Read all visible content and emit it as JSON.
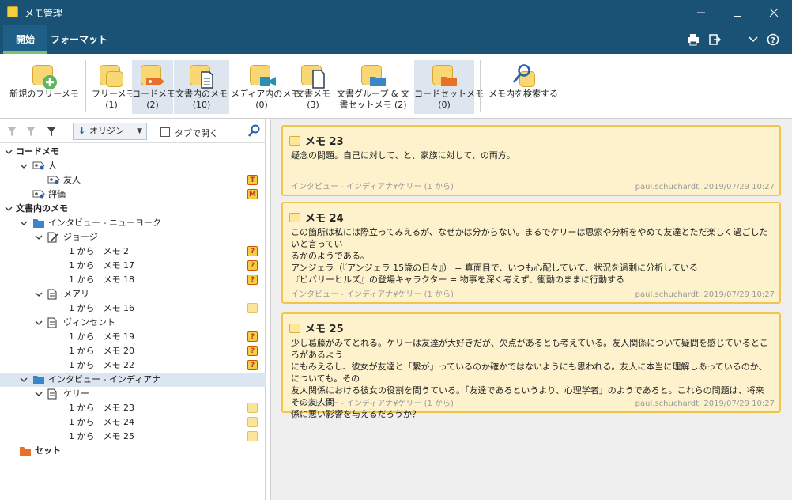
{
  "window": {
    "title": "メモ管理"
  },
  "tabs": {
    "start": "開始",
    "format": "フォーマット"
  },
  "ribbon": {
    "new_free": "新規のフリーメモ",
    "free": {
      "label": "フリーメモ",
      "count": "(1)"
    },
    "code": {
      "label": "コードメモ",
      "count": "(2)"
    },
    "doc": {
      "label": "文書内のメモ",
      "count": "(10)"
    },
    "media": {
      "label": "メディア内のメモ",
      "count": "(0)"
    },
    "docmemo": {
      "label": "文書メモ",
      "count": "(3)"
    },
    "docgroup": {
      "label": "文書グループ & 文",
      "label2": "書セットメモ (2)"
    },
    "codeset": {
      "label": "コードセットメモ",
      "count": "(0)"
    },
    "search": "メモ内を検索する"
  },
  "toolbar": {
    "origin": "オリジン",
    "tab_open": "タブで開く"
  },
  "tree": [
    {
      "label": "コードメモ",
      "level": 0,
      "exp": "v",
      "icon": "none",
      "bold": true
    },
    {
      "label": "人",
      "level": 1,
      "exp": "v",
      "icon": "code"
    },
    {
      "label": "友人",
      "level": 2,
      "exp": "",
      "icon": "code",
      "badge": "T"
    },
    {
      "label": "評価",
      "level": 1,
      "exp": "",
      "icon": "code",
      "badge": "M"
    },
    {
      "label": "文書内のメモ",
      "level": 0,
      "exp": "v",
      "icon": "none",
      "bold": true
    },
    {
      "label": "インタビュー - ニューヨーク",
      "level": 1,
      "exp": "v",
      "icon": "folder"
    },
    {
      "label": "ジョージ",
      "level": 2,
      "exp": "v",
      "icon": "docedit"
    },
    {
      "label": "1 から　メモ 2",
      "level": 3,
      "exp": "",
      "icon": "none",
      "badge": "?"
    },
    {
      "label": "1 から　メモ 17",
      "level": 3,
      "exp": "",
      "icon": "none",
      "badge": "?"
    },
    {
      "label": "1 から　メモ 18",
      "level": 3,
      "exp": "",
      "icon": "none",
      "badge": "?"
    },
    {
      "label": "メアリ",
      "level": 2,
      "exp": "v",
      "icon": "doc"
    },
    {
      "label": "1 から　メモ 16",
      "level": 3,
      "exp": "",
      "icon": "none",
      "badge": "N"
    },
    {
      "label": "ヴィンセント",
      "level": 2,
      "exp": "v",
      "icon": "doc"
    },
    {
      "label": "1 から　メモ 19",
      "level": 3,
      "exp": "",
      "icon": "none",
      "badge": "?"
    },
    {
      "label": "1 から　メモ 20",
      "level": 3,
      "exp": "",
      "icon": "none",
      "badge": "?"
    },
    {
      "label": "1 から　メモ 22",
      "level": 3,
      "exp": "",
      "icon": "none",
      "badge": "?"
    },
    {
      "label": "インタビュー - インディアナ",
      "level": 1,
      "exp": "v",
      "icon": "folder",
      "selected": true
    },
    {
      "label": "ケリー",
      "level": 2,
      "exp": "v",
      "icon": "doc"
    },
    {
      "label": "1 から　メモ 23",
      "level": 3,
      "exp": "",
      "icon": "none",
      "badge": "N"
    },
    {
      "label": "1 から　メモ 24",
      "level": 3,
      "exp": "",
      "icon": "none",
      "badge": "N"
    },
    {
      "label": "1 から　メモ 25",
      "level": 3,
      "exp": "",
      "icon": "none",
      "badge": "N"
    },
    {
      "label": "セット",
      "level": 0,
      "exp": "",
      "icon": "setfolder",
      "bold": true
    }
  ],
  "memos": [
    {
      "title": "メモ 23",
      "lines": [
        "疑念の問題。自己に対して、と、家族に対して、の両方。"
      ],
      "source": "インタビュー - インディアナ¥ケリー (1 から)",
      "meta": "paul.schuchardt, 2019/07/29 10:27"
    },
    {
      "title": "メモ 24",
      "lines": [
        "この箇所は私には際立ってみえるが、なぜかは分からない。まるでケリーは思索や分析をやめて友達とただ楽しく過ごしたいと言ってい",
        "るかのようである。",
        "アンジェラ（『アンジェラ 15歳の日々』） = 真面目で、いつも心配していて、状況を過剰に分析している",
        "『ビバリーヒルズ』の登場キャラクター = 物事を深く考えず、衝動のままに行動する"
      ],
      "source": "インタビュー - インディアナ¥ケリー (1 から)",
      "meta": "paul.schuchardt, 2019/07/29 10:27"
    },
    {
      "title": "メモ 25",
      "lines": [
        "少し葛藤がみてとれる。ケリーは友達が大好きだが、欠点があるとも考えている。友人関係について疑問を感じているところがあるよう",
        "にもみえるし、彼女が友達と「繋が」っているのか確かではないようにも思われる。友人に本当に理解しあっているのか、についても。その",
        "友人関係における彼女の役割を問うている。「友達であるというより、心理学者」のようであると。これらの問題は、将来その友人関",
        "係に悪い影響を与えるだろうか？"
      ],
      "source": "インタビュー - インディアナ¥ケリー (1 から)",
      "meta": "paul.schuchardt, 2019/07/29 10:27"
    }
  ]
}
